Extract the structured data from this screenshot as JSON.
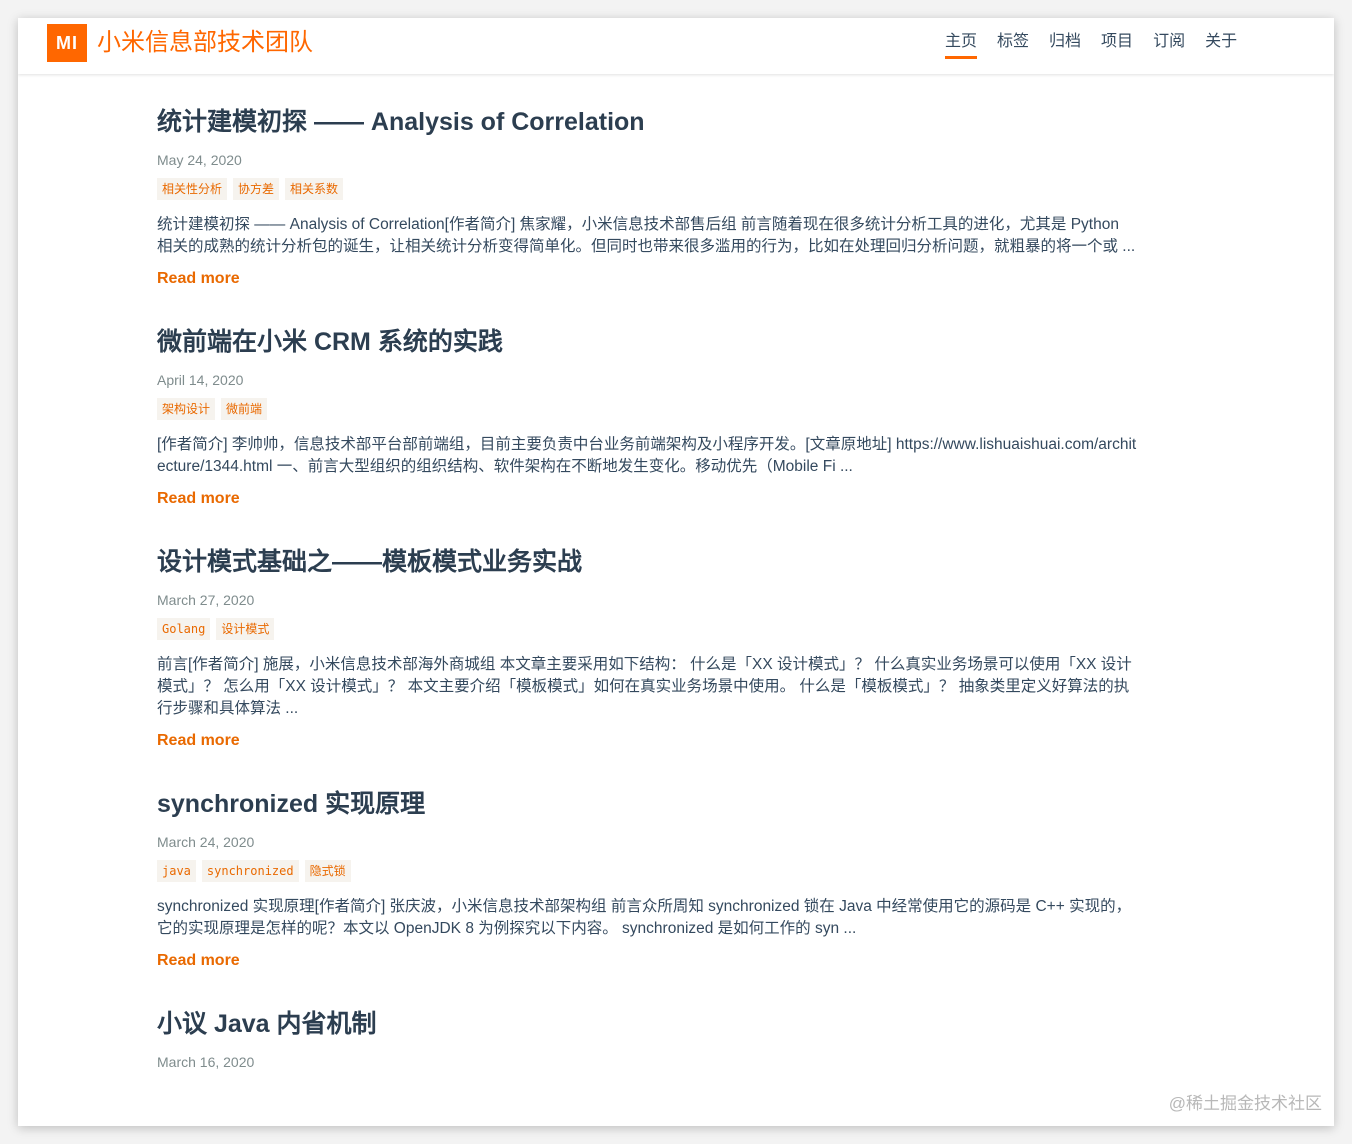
{
  "header": {
    "logo_text": "MI",
    "site_title": "小米信息部技术团队",
    "nav": [
      "主页",
      "标签",
      "归档",
      "项目",
      "订阅",
      "关于"
    ],
    "active_nav": "主页"
  },
  "posts": [
    {
      "title": "统计建模初探 —— Analysis of Correlation",
      "date": "May 24, 2020",
      "tags": [
        "相关性分析",
        "协方差",
        "相关系数"
      ],
      "excerpt": "统计建模初探 —— Analysis of Correlation[作者简介] 焦家耀，小米信息技术部售后组 前言随着现在很多统计分析工具的进化，尤其是 Python 相关的成熟的统计分析包的诞生，让相关统计分析变得简单化。但同时也带来很多滥用的行为，比如在处理回归分析问题，就粗暴的将一个或 ...",
      "read_more": "Read more"
    },
    {
      "title": "微前端在小米 CRM 系统的实践",
      "date": "April 14, 2020",
      "tags": [
        "架构设计",
        "微前端"
      ],
      "excerpt": "[作者简介] 李帅帅，信息技术部平台部前端组，目前主要负责中台业务前端架构及小程序开发。[文章原地址] https://www.lishuaishuai.com/architecture/1344.html 一、前言大型组织的组织结构、软件架构在不断地发生变化。移动优先（Mobile Fi ...",
      "read_more": "Read more"
    },
    {
      "title": "设计模式基础之——模板模式业务实战",
      "date": "March 27, 2020",
      "tags": [
        "Golang",
        "设计模式"
      ],
      "excerpt": "前言[作者简介] 施展，小米信息技术部海外商城组 本文章主要采用如下结构： 什么是「XX 设计模式」？ 什么真实业务场景可以使用「XX 设计模式」？ 怎么用「XX 设计模式」？ 本文主要介绍「模板模式」如何在真实业务场景中使用。 什么是「模板模式」？ 抽象类里定义好算法的执行步骤和具体算法 ...",
      "read_more": "Read more"
    },
    {
      "title": "synchronized 实现原理",
      "date": "March 24, 2020",
      "tags": [
        "java",
        "synchronized",
        "隐式锁"
      ],
      "excerpt": "synchronized 实现原理[作者简介] 张庆波，小米信息技术部架构组 前言众所周知 synchronized 锁在 Java 中经常使用它的源码是 C++ 实现的，它的实现原理是怎样的呢？本文以 OpenJDK 8 为例探究以下内容。 synchronized 是如何工作的 syn ...",
      "read_more": "Read more"
    },
    {
      "title": "小议 Java 内省机制",
      "date": "March 16, 2020",
      "tags": [],
      "excerpt": "",
      "read_more": ""
    }
  ],
  "watermark": "@稀土掘金技术社区",
  "colors": {
    "accent": "#ff6700",
    "link": "#e96900",
    "text": "#34495e",
    "tag_bg": "#f6f3ee"
  }
}
